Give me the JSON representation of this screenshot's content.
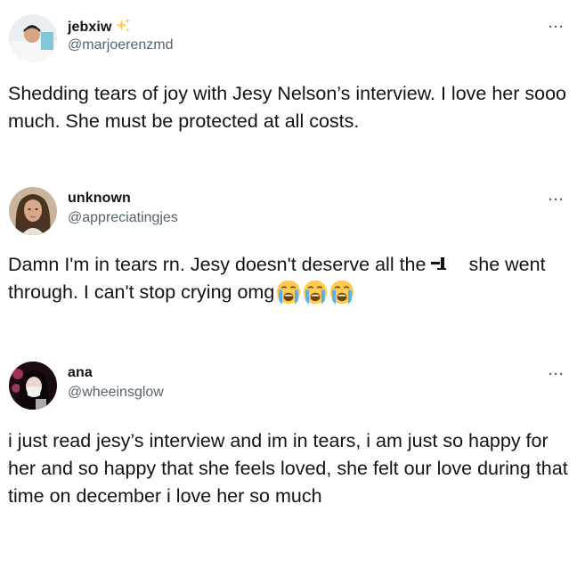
{
  "tweets": [
    {
      "display_name": "jebxiw",
      "handle": "@marjoerenzmd",
      "badge_icon": "sparkles-icon",
      "text": "Shedding tears of joy with Jesy Nelson’s interview. I love her sooo much. She must be protected at all costs."
    },
    {
      "display_name": "unknown",
      "handle": "@appreciatingjes",
      "text_part_1": "Damn I'm in tears rn. Jesy doesn't deserve all the",
      "hidden_glyph_icon": "missing-glyph-icon",
      "text_part_2": "she went through. I can't stop crying omg",
      "emojis": [
        "😭",
        "😭",
        "😭"
      ],
      "emoji_icon": "loudly-crying-face-icon"
    },
    {
      "display_name": "ana",
      "handle": "@wheeinsglow",
      "text": "i just read jesy’s interview and im in tears, i am just so happy for her and so happy that she feels loved, she felt our love during that time on december i love her so much"
    }
  ],
  "more_label": "···",
  "colors": {
    "text_primary": "#0f1419",
    "text_secondary": "#536471",
    "background": "#ffffff",
    "sparkle": "#ffcc4d"
  }
}
